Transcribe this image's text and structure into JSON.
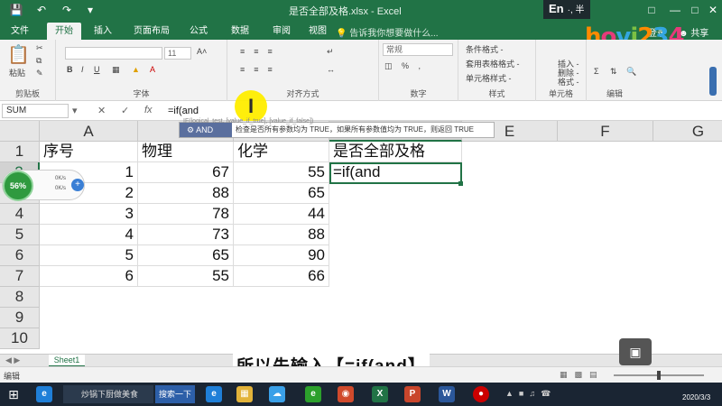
{
  "window": {
    "title": "是否全部及格.xlsx - Excel",
    "ime_label": "En",
    "ime_extra": "·, 半"
  },
  "tabs": [
    "文件",
    "开始",
    "插入",
    "页面布局",
    "公式",
    "数据",
    "审阅",
    "视图"
  ],
  "active_tab": "开始",
  "tell_me": "告诉我你想要做什么...",
  "account": {
    "login": "登录",
    "share": "共享"
  },
  "logo_text": "hovi234",
  "ribbon": {
    "groups": [
      "剪贴板",
      "字体",
      "对齐方式",
      "数字",
      "样式",
      "单元格",
      "编辑"
    ],
    "paste": "粘贴",
    "font_size": "11",
    "number_format": "常规",
    "styles": [
      "条件格式 -",
      "套用表格格式 -",
      "单元格样式 -"
    ],
    "cells": [
      "插入 -",
      "删除 -",
      "格式 -"
    ]
  },
  "formula_bar": {
    "name_box": "SUM",
    "formula": "=if(and"
  },
  "autocomplete": {
    "item": "AND",
    "description": "检查是否所有参数均为 TRUE，如果所有参数值均为 TRUE，则返回 TRUE",
    "signature": "IF(logical_test, [value_if_true], [value_if_false])"
  },
  "sheet": {
    "columns": [
      "A",
      "B",
      "C",
      "D",
      "E",
      "F",
      "G"
    ],
    "rows": [
      "1",
      "2",
      "3",
      "4",
      "5",
      "6",
      "7",
      "8",
      "9",
      "10"
    ],
    "headers": [
      "序号",
      "物理",
      "化学",
      "是否全部及格"
    ],
    "data": [
      [
        "1",
        "67",
        "55"
      ],
      [
        "2",
        "88",
        "65"
      ],
      [
        "3",
        "78",
        "44"
      ],
      [
        "4",
        "73",
        "88"
      ],
      [
        "5",
        "65",
        "90"
      ],
      [
        "6",
        "55",
        "66"
      ]
    ],
    "editing_cell": "=if(and",
    "tab": "Sheet1"
  },
  "speed_widget": {
    "percent": "56%",
    "up": "0K/s",
    "down": "0K/s"
  },
  "subtitle": "所以先输入【=if(and】",
  "status": {
    "mode": "编辑"
  },
  "taskbar": {
    "browser_task": "炒锅下厨做美食",
    "search_task": "搜索一下",
    "clock": "2020/3/3"
  },
  "colors": {
    "excel_green": "#217346",
    "taskbar": "#1a2533"
  }
}
